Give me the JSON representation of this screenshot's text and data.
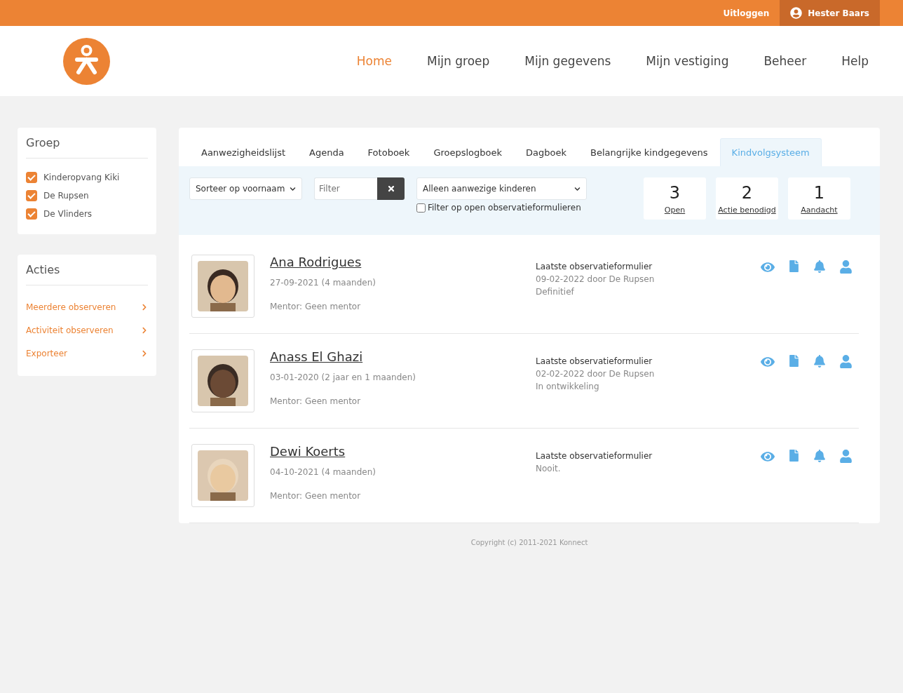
{
  "topbar": {
    "logout": "Uitloggen",
    "user": "Hester Baars"
  },
  "nav": [
    {
      "label": "Home",
      "selected": true
    },
    {
      "label": "Mijn groep",
      "selected": false
    },
    {
      "label": "Mijn gegevens",
      "selected": false
    },
    {
      "label": "Mijn vestiging",
      "selected": false
    },
    {
      "label": "Beheer",
      "selected": false
    },
    {
      "label": "Help",
      "selected": false
    }
  ],
  "sidebar": {
    "group": {
      "title": "Groep",
      "items": [
        {
          "label": "Kinderopvang Kiki",
          "checked": true
        },
        {
          "label": "De Rupsen",
          "checked": true
        },
        {
          "label": "De Vlinders",
          "checked": true
        }
      ]
    },
    "actions": {
      "title": "Acties",
      "items": [
        "Meerdere observeren",
        "Activiteit observeren",
        "Exporteer"
      ]
    }
  },
  "tabs": [
    {
      "label": "Aanwezigheidslijst",
      "selected": false
    },
    {
      "label": "Agenda",
      "selected": false
    },
    {
      "label": "Fotoboek",
      "selected": false
    },
    {
      "label": "Groepslogboek",
      "selected": false
    },
    {
      "label": "Dagboek",
      "selected": false
    },
    {
      "label": "Belangrijke kindgegevens",
      "selected": false
    },
    {
      "label": "Kindvolgsysteem",
      "selected": true
    }
  ],
  "filters": {
    "sort": "Sorteer op voornaam",
    "filter_placeholder": "Filter",
    "presence": "Alleen aanwezige kinderen",
    "open_forms": {
      "label": "Filter op open observatieformulieren",
      "checked": false
    }
  },
  "counters": [
    {
      "value": "3",
      "label": "Open"
    },
    {
      "value": "2",
      "label": "Actie benodigd"
    },
    {
      "value": "1",
      "label": "Aandacht"
    }
  ],
  "children": [
    {
      "name": "Ana Rodrigues",
      "birth": "27-09-2021 (4 maanden)",
      "mentor": "Mentor: Geen mentor",
      "form_title": "Laatste observatieformulier",
      "form_lines": [
        "09-02-2022 door De Rupsen",
        "Definitief"
      ]
    },
    {
      "name": "Anass El Ghazi",
      "birth": "03-01-2020 (2 jaar en 1 maanden)",
      "mentor": "Mentor: Geen mentor",
      "form_title": "Laatste observatieformulier",
      "form_lines": [
        "02-02-2022 door De Rupsen",
        "In ontwikkeling"
      ]
    },
    {
      "name": "Dewi Koerts",
      "birth": "04-10-2021 (4 maanden)",
      "mentor": "Mentor: Geen mentor",
      "form_title": "Laatste observatieformulier",
      "form_lines": [
        "Nooit."
      ]
    }
  ],
  "footer": "Copyright (c) 2011-2021 Konnect"
}
